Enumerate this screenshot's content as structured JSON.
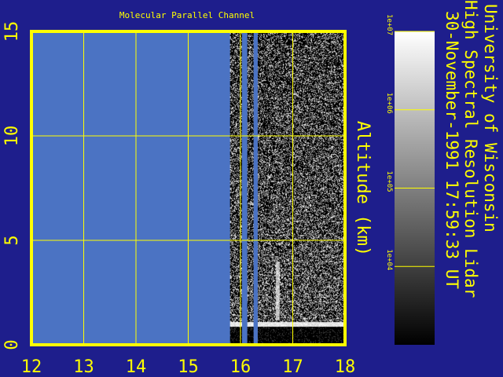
{
  "chart_data": {
    "type": "heatmap",
    "title": "Molecular Parallel Channel",
    "xlabel": "",
    "ylabel": "Altitude (km)",
    "xlim": [
      12,
      18
    ],
    "ylim": [
      0,
      15
    ],
    "x_ticks": [
      "12",
      "13",
      "14",
      "15",
      "16",
      "17",
      "18"
    ],
    "y_ticks": [
      "0",
      "5",
      "10",
      "15"
    ],
    "grid": true,
    "data_start_hour": 15.8,
    "data_gaps": [
      [
        16.03,
        16.13
      ],
      [
        16.25,
        16.33
      ]
    ],
    "surface_layer_km": 1.0,
    "plume": {
      "x": 16.7,
      "bottom_km": 1.2,
      "top_km": 4.0
    },
    "colorbar": {
      "scale": "log",
      "labels": [
        "1e+07",
        "1e+06",
        "1e+05",
        "1e+04"
      ],
      "range": [
        1000,
        10000000
      ]
    },
    "annotations": {
      "institution": "University of Wisconsin",
      "instrument": "High Spectral Resolution Lidar",
      "timestamp": "30-November-1991 17:59:33 UT"
    },
    "colors": {
      "background": "#1e1e8c",
      "no_data": "#4b73c3",
      "frame": "#ffff00",
      "grid": "#ffff00"
    }
  }
}
